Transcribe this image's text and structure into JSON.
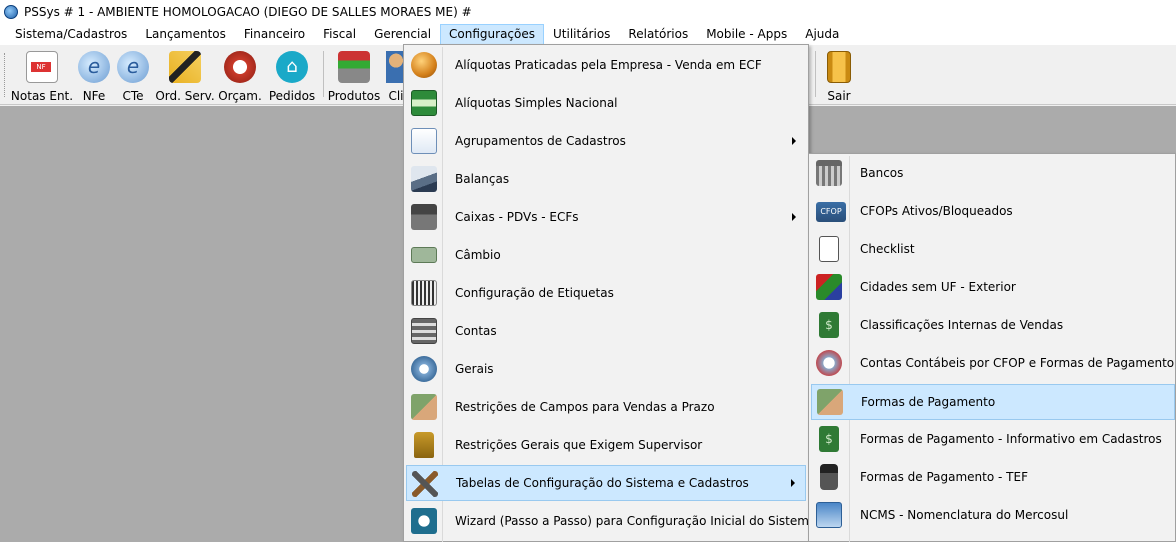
{
  "window": {
    "title": "PSSys # 1 - AMBIENTE HOMOLOGACAO (DIEGO DE SALLES MORAES ME) #"
  },
  "menubar": {
    "items": [
      {
        "label": "Sistema/Cadastros"
      },
      {
        "label": "Lançamentos"
      },
      {
        "label": "Financeiro"
      },
      {
        "label": "Fiscal"
      },
      {
        "label": "Gerencial"
      },
      {
        "label": "Configurações"
      },
      {
        "label": "Utilitários"
      },
      {
        "label": "Relatórios"
      },
      {
        "label": "Mobile - Apps"
      },
      {
        "label": "Ajuda"
      }
    ],
    "active": "Configurações"
  },
  "toolbar": {
    "buttons": [
      {
        "label": "Notas Ent.",
        "icon": "invoice-icon"
      },
      {
        "label": "NFe",
        "icon": "nfe-icon"
      },
      {
        "label": "CTe",
        "icon": "cte-icon"
      },
      {
        "label": "Ord. Serv.",
        "icon": "service-order-icon"
      },
      {
        "label": "Orçam.",
        "icon": "budget-icon"
      },
      {
        "label": "Pedidos",
        "icon": "basket-icon"
      },
      {
        "label": "Produtos",
        "icon": "cart-icon"
      },
      {
        "label": "Cli",
        "icon": "clients-icon"
      },
      {
        "label": "Sair",
        "icon": "exit-door-icon"
      }
    ]
  },
  "configuracoes_menu": {
    "items": [
      {
        "label": "Alíquotas Praticadas pela Empresa - Venda em ECF",
        "icon": "coins-icon",
        "submenu": false
      },
      {
        "label": "Alíquotas Simples Nacional",
        "icon": "simples-card-icon",
        "submenu": false
      },
      {
        "label": "Agrupamentos de Cadastros",
        "icon": "grouping-icon",
        "submenu": true
      },
      {
        "label": "Balanças",
        "icon": "scale-icon",
        "submenu": false
      },
      {
        "label": "Caixas - PDVs - ECFs",
        "icon": "cash-register-icon",
        "submenu": true
      },
      {
        "label": "Câmbio",
        "icon": "banknote-icon",
        "submenu": false
      },
      {
        "label": "Configuração de Etiquetas",
        "icon": "label-printer-icon",
        "submenu": false
      },
      {
        "label": "Contas",
        "icon": "calculator-icon",
        "submenu": false
      },
      {
        "label": "Gerais",
        "icon": "gears-icon",
        "submenu": false
      },
      {
        "label": "Restrições de Campos para Vendas a Prazo",
        "icon": "money-hand-icon",
        "submenu": false
      },
      {
        "label": "Restrições Gerais que Exigem Supervisor",
        "icon": "padlock-icon",
        "submenu": false
      },
      {
        "label": "Tabelas de Configuração do Sistema e Cadastros",
        "icon": "tools-icon",
        "submenu": true,
        "selected": true
      },
      {
        "label": "Wizard (Passo a Passo) para Configuração Inicial do Sistema",
        "icon": "wizard-icon",
        "submenu": false
      }
    ]
  },
  "tabelas_submenu": {
    "items": [
      {
        "label": "Bancos",
        "icon": "bank-icon"
      },
      {
        "label": "CFOPs Ativos/Bloqueados",
        "icon": "cfop-icon",
        "icon_text": "CFOP"
      },
      {
        "label": "Checklist",
        "icon": "checklist-icon"
      },
      {
        "label": "Cidades sem UF - Exterior",
        "icon": "flags-icon"
      },
      {
        "label": "Classificações Internas de Vendas",
        "icon": "dollar-note-icon"
      },
      {
        "label": "Contas Contábeis por CFOP e Formas de Pagamento",
        "icon": "accounts-icon"
      },
      {
        "label": "Formas de Pagamento",
        "icon": "payment-hand-icon",
        "selected": true
      },
      {
        "label": "Formas de Pagamento - Informativo em Cadastros",
        "icon": "dollar-note-icon"
      },
      {
        "label": "Formas de Pagamento - TEF",
        "icon": "pos-terminal-icon"
      },
      {
        "label": "NCMS - Nomenclatura do Mercosul",
        "icon": "ncm-icon"
      }
    ]
  },
  "colors": {
    "selection_bg": "#cce8ff",
    "selection_border": "#99c9ef",
    "workspace": "#ababab",
    "menu_bg": "#f2f2f2"
  }
}
